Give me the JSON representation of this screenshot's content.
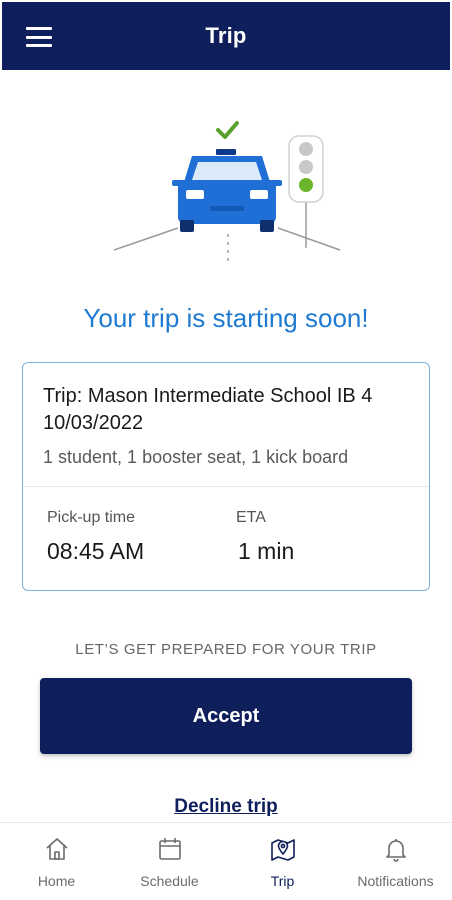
{
  "header": {
    "title": "Trip",
    "menu_icon": "hamburger-menu-icon"
  },
  "illustration": {
    "icons": [
      "car-icon",
      "traffic-light-icon",
      "checkmark-icon"
    ],
    "colors": {
      "car": "#1f6fd6",
      "check": "#5aa02c",
      "green_light": "#6bb52a",
      "grey_light": "#c8c8c8"
    }
  },
  "headline": "Your trip is starting soon!",
  "trip": {
    "name": "Trip: Mason Intermediate School IB 4 10/03/2022",
    "details": "1 student, 1 booster seat, 1 kick board",
    "pickup_label": "Pick-up time",
    "pickup_value": "08:45 AM",
    "eta_label": "ETA",
    "eta_value": "1 min"
  },
  "prep_text": "LET’S GET PREPARED FOR YOUR TRIP",
  "accept_label": "Accept",
  "decline_label": "Decline trip",
  "tabs": [
    {
      "label": "Home",
      "icon": "home-icon",
      "active": false
    },
    {
      "label": "Schedule",
      "icon": "calendar-icon",
      "active": false
    },
    {
      "label": "Trip",
      "icon": "map-pin-icon",
      "active": true
    },
    {
      "label": "Notifications",
      "icon": "bell-icon",
      "active": false
    }
  ],
  "colors": {
    "primary": "#0f1f5c",
    "accent": "#1f7ad1",
    "card_border": "#7fb2dc"
  }
}
